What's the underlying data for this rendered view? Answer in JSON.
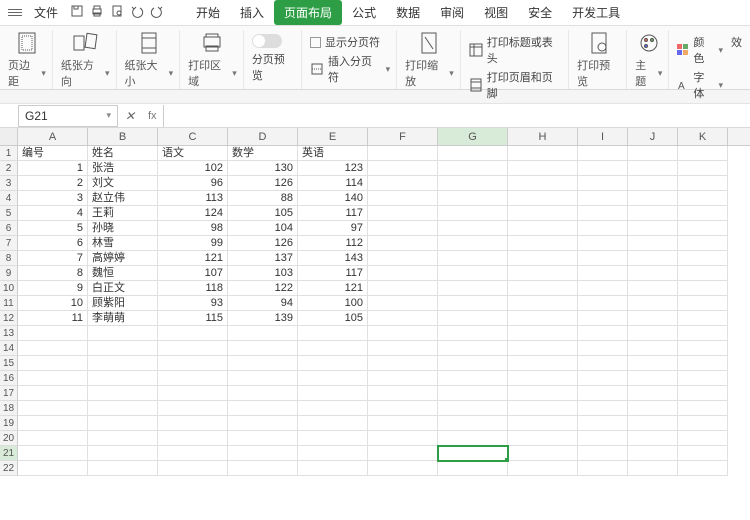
{
  "menubar": {
    "file": "文件"
  },
  "tabs": [
    "开始",
    "插入",
    "页面布局",
    "公式",
    "数据",
    "审阅",
    "视图",
    "安全",
    "开发工具"
  ],
  "activeTabIndex": 2,
  "ribbon": {
    "margins": "页边距",
    "orientation": "纸张方向",
    "size": "纸张大小",
    "printarea": "打印区域",
    "pagebreak_preview": "分页预览",
    "show_pagebreak": "显示分页符",
    "insert_pagebreak": "插入分页符",
    "print_scale": "打印缩放",
    "print_titles": "打印标题或表头",
    "print_headerfooter": "打印页眉和页脚",
    "print_preview": "打印预览",
    "theme": "主题",
    "color": "颜色",
    "font": "字体",
    "effect": "效"
  },
  "formulabar": {
    "cellref": "G21",
    "fx": "fx"
  },
  "columns": [
    "A",
    "B",
    "C",
    "D",
    "E",
    "F",
    "G",
    "H",
    "I",
    "J",
    "K"
  ],
  "headers": {
    "A": "编号",
    "B": "姓名",
    "C": "语文",
    "D": "数学",
    "E": "英语"
  },
  "chart_data": {
    "type": "table",
    "title": "",
    "columns": [
      "编号",
      "姓名",
      "语文",
      "数学",
      "英语"
    ],
    "rows": [
      [
        1,
        "张浩",
        102,
        130,
        123
      ],
      [
        2,
        "刘文",
        96,
        126,
        114
      ],
      [
        3,
        "赵立伟",
        113,
        88,
        140
      ],
      [
        4,
        "王莉",
        124,
        105,
        117
      ],
      [
        5,
        "孙晓",
        98,
        104,
        97
      ],
      [
        6,
        "林雪",
        99,
        126,
        112
      ],
      [
        7,
        "高婷婷",
        121,
        137,
        143
      ],
      [
        8,
        "魏恒",
        107,
        103,
        117
      ],
      [
        9,
        "白正文",
        118,
        122,
        121
      ],
      [
        10,
        "顾紫阳",
        93,
        94,
        100
      ],
      [
        11,
        "李萌萌",
        115,
        139,
        105
      ]
    ]
  },
  "activeCell": {
    "col": "G",
    "row": 21
  },
  "blankRows": [
    13,
    14,
    15,
    16,
    17,
    18,
    19,
    20,
    21,
    22
  ]
}
